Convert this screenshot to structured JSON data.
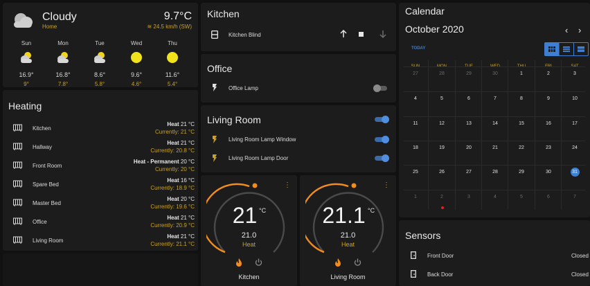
{
  "weather": {
    "condition": "Cloudy",
    "location": "Home",
    "temperature": "9.7°C",
    "wind": "24.5 km/h (SW)",
    "forecast": [
      {
        "day": "Sun",
        "icon": "partly-cloudy-icon",
        "high": "16.9°",
        "low": "9°"
      },
      {
        "day": "Mon",
        "icon": "partly-cloudy-icon",
        "high": "16.8°",
        "low": "7.8°"
      },
      {
        "day": "Tue",
        "icon": "partly-cloudy-icon",
        "high": "8.6°",
        "low": "5.8°"
      },
      {
        "day": "Wed",
        "icon": "sunny-icon",
        "high": "9.6°",
        "low": "4.6°"
      },
      {
        "day": "Thu",
        "icon": "sunny-icon",
        "high": "11.6°",
        "low": "5.4°"
      }
    ]
  },
  "heating": {
    "title": "Heating",
    "rooms": [
      {
        "name": "Kitchen",
        "mode": "Heat",
        "target": "21 °C",
        "current": "Currently: 21 °C"
      },
      {
        "name": "Hallway",
        "mode": "Heat",
        "target": "21 °C",
        "current": "Currently: 20.8 °C"
      },
      {
        "name": "Front Room",
        "mode": "Heat - Permanent",
        "target": "20 °C",
        "current": "Currently: 20 °C"
      },
      {
        "name": "Spare Bed",
        "mode": "Heat",
        "target": "16 °C",
        "current": "Currently: 18.9 °C"
      },
      {
        "name": "Master Bed",
        "mode": "Heat",
        "target": "20 °C",
        "current": "Currently: 19.6 °C"
      },
      {
        "name": "Office",
        "mode": "Heat",
        "target": "21 °C",
        "current": "Currently: 20.9 °C"
      },
      {
        "name": "Living Room",
        "mode": "Heat",
        "target": "21 °C",
        "current": "Currently: 21.1 °C"
      }
    ]
  },
  "kitchen": {
    "title": "Kitchen",
    "blind_label": "Kitchen Blind"
  },
  "office": {
    "title": "Office",
    "lamp_label": "Office Lamp",
    "lamp_on": false
  },
  "living_room": {
    "title": "Living Room",
    "group_on": true,
    "lamps": [
      {
        "label": "Living Room Lamp Window",
        "on": true
      },
      {
        "label": "Living Room Lamp Door",
        "on": true
      }
    ]
  },
  "thermostats": [
    {
      "name": "Kitchen",
      "current": "21",
      "unit": "°C",
      "target": "21.0",
      "mode": "Heat"
    },
    {
      "name": "Living Room",
      "current": "21.1",
      "unit": "°C",
      "target": "21.0",
      "mode": "Heat"
    }
  ],
  "calendar": {
    "title": "Calendar",
    "month": "October 2020",
    "today_label": "TODAY",
    "weekdays": [
      "SUN",
      "MON",
      "TUE",
      "WED",
      "THU",
      "FRI",
      "SAT"
    ],
    "weeks": [
      [
        "27",
        "28",
        "29",
        "30",
        "1",
        "2",
        "3"
      ],
      [
        "4",
        "5",
        "6",
        "7",
        "8",
        "9",
        "10"
      ],
      [
        "11",
        "12",
        "13",
        "14",
        "15",
        "16",
        "17"
      ],
      [
        "18",
        "19",
        "20",
        "21",
        "22",
        "23",
        "24"
      ],
      [
        "25",
        "26",
        "27",
        "28",
        "29",
        "30",
        "31"
      ],
      [
        "1",
        "2",
        "3",
        "4",
        "5",
        "6",
        "7"
      ]
    ],
    "today": "31"
  },
  "sensors": {
    "title": "Sensors",
    "items": [
      {
        "name": "Front Door",
        "state": "Closed"
      },
      {
        "name": "Back Door",
        "state": "Closed"
      }
    ]
  },
  "colors": {
    "accent": "#c9a227",
    "toggle_on": "#3f7fd1",
    "today": "#3f7fd1",
    "arc": "#f28c1c",
    "event": "#e0201b"
  }
}
